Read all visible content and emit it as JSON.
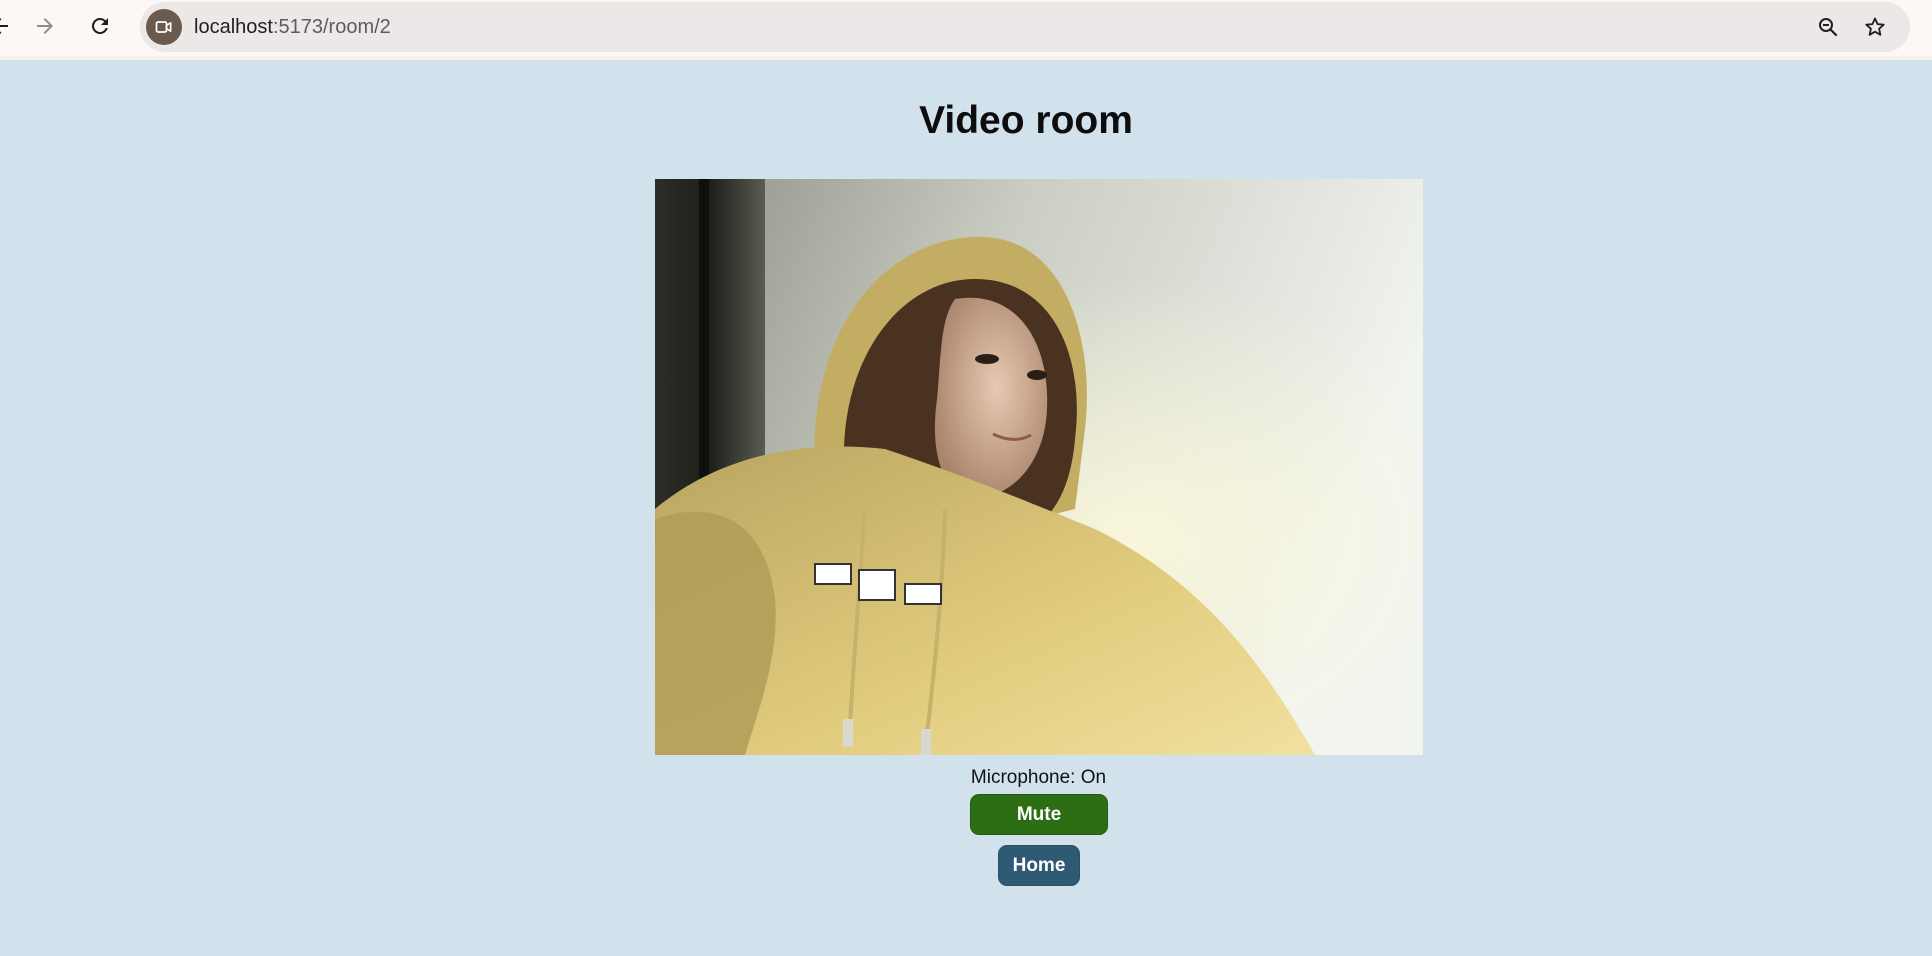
{
  "browser": {
    "url_host": "localhost",
    "url_path": ":5173/room/2",
    "icons": {
      "back": "arrow-left-icon",
      "forward": "arrow-right-icon",
      "reload": "reload-icon",
      "site": "video-camera-icon",
      "zoom": "zoom-out-icon",
      "bookmark": "star-icon"
    }
  },
  "page": {
    "title": "Video room",
    "microphone_status": "Microphone: On",
    "mute_label": "Mute",
    "home_label": "Home"
  },
  "colors": {
    "page_background": "#d2e2ec",
    "mute_button": "#2d6d14",
    "home_button": "#2f5a73"
  }
}
